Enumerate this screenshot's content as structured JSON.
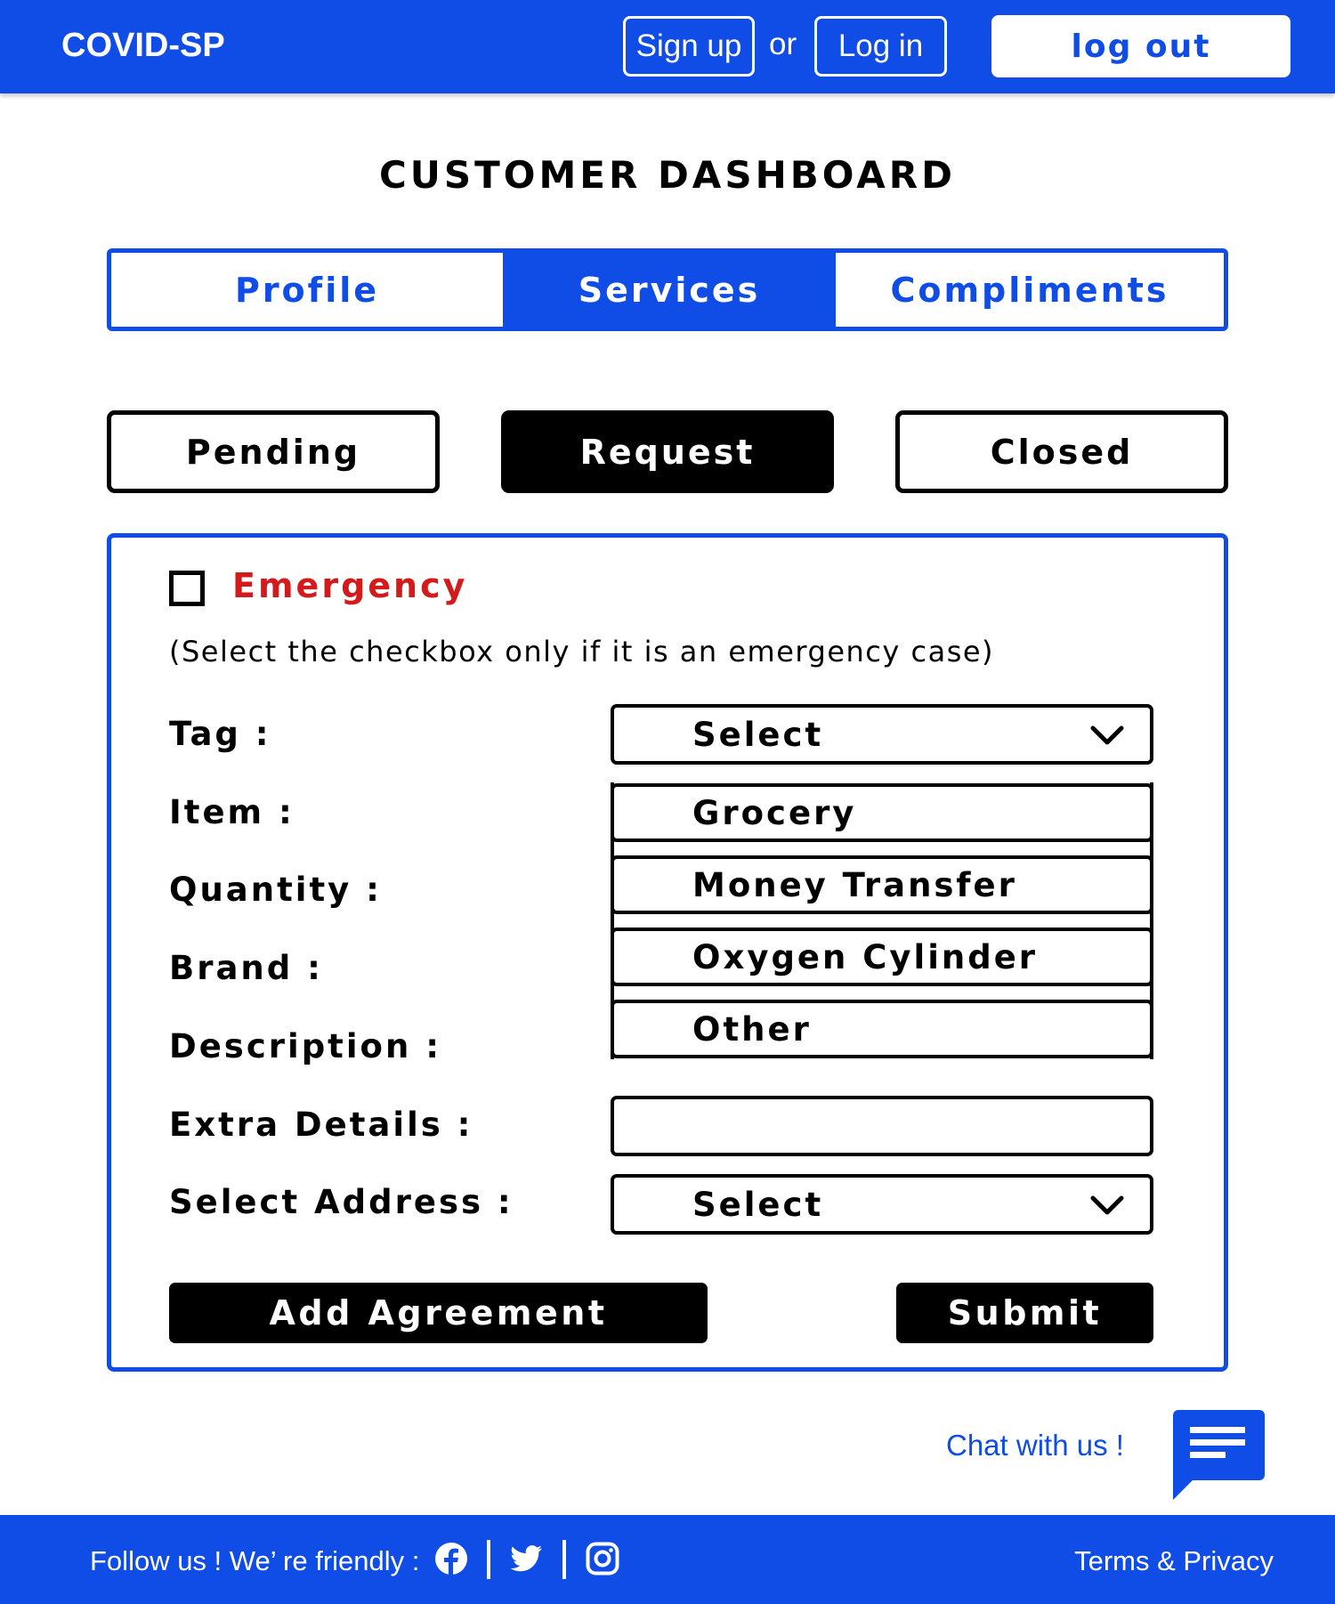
{
  "header": {
    "brand": "COVID-SP",
    "signup_label": "Sign up",
    "or_text": "or",
    "login_label": "Log in",
    "logout_label": "log out"
  },
  "page_title": "CUSTOMER DASHBOARD",
  "tabs": [
    {
      "label": "Profile",
      "active": false
    },
    {
      "label": "Services",
      "active": true
    },
    {
      "label": "Compliments",
      "active": false
    }
  ],
  "subtabs": [
    {
      "label": "Pending",
      "active": false
    },
    {
      "label": "Request",
      "active": true
    },
    {
      "label": "Closed",
      "active": false
    }
  ],
  "form": {
    "emergency_label": "Emergency",
    "emergency_checked": false,
    "emergency_hint": "(Select the checkbox only if it is an emergency case)",
    "labels": {
      "tag": "Tag :",
      "item": "Item :",
      "quantity": "Quantity :",
      "brand": "Brand :",
      "description": "Description :",
      "extra_details": "Extra Details :",
      "select_address": "Select Address :"
    },
    "tag_select_value": "Select",
    "tag_options": [
      "Grocery",
      "Money Transfer",
      "Oxygen Cylinder",
      "Other"
    ],
    "extra_details_value": "",
    "address_select_value": "Select",
    "add_agreement_label": "Add Agreement",
    "submit_label": "Submit"
  },
  "chat": {
    "label": "Chat with us !",
    "icon": "chat-bubble-icon"
  },
  "footer": {
    "follow_text": "Follow us !  We’ re friendly :",
    "social_icons": [
      "facebook-icon",
      "twitter-icon",
      "instagram-icon"
    ],
    "terms_label": "Terms & Privacy"
  },
  "colors": {
    "primary_blue": "#0f4de6",
    "emergency_red": "#d41a1a",
    "black": "#000000",
    "white": "#ffffff"
  }
}
